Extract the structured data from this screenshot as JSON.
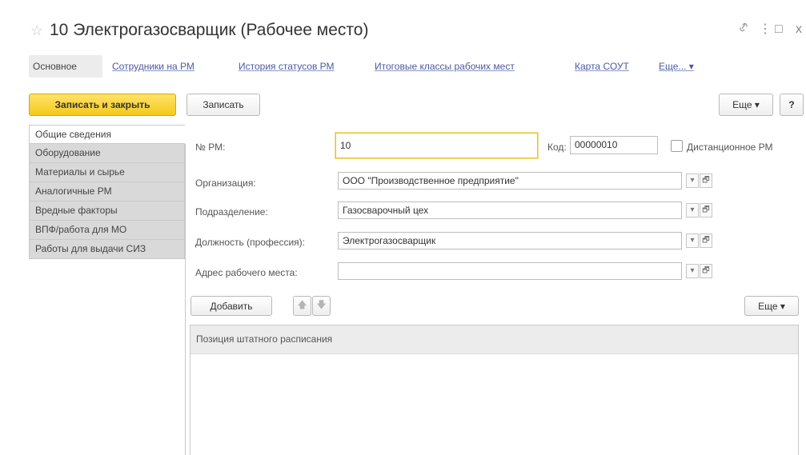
{
  "window": {
    "title": "10 Электрогазосварщик (Рабочее место)",
    "star_icon": "☆",
    "link_icon": "🔗",
    "menu_icon": "⋮",
    "maximize_icon": "□",
    "close_icon": "x"
  },
  "nav": {
    "items": [
      {
        "label": "Основное",
        "active": true
      },
      {
        "label": "Сотрудники на РМ"
      },
      {
        "label": "История статусов РМ"
      },
      {
        "label": "Итоговые классы рабочих мест"
      },
      {
        "label": "Карта СОУТ"
      },
      {
        "label": "Еще... ▾"
      }
    ]
  },
  "toolbar": {
    "save_close_label": "Записать и закрыть",
    "save_label": "Записать",
    "more_label": "Еще ▾",
    "help_label": "?"
  },
  "tabs": [
    {
      "label": "Общие сведения",
      "active": true
    },
    {
      "label": "Оборудование"
    },
    {
      "label": "Материалы и сырье"
    },
    {
      "label": "Аналогичные РМ"
    },
    {
      "label": "Вредные факторы"
    },
    {
      "label": "ВПФ/работа для МО"
    },
    {
      "label": "Работы для выдачи СИЗ"
    }
  ],
  "form": {
    "number_label": "№ РМ:",
    "number_value": "10",
    "code_label": "Код:",
    "code_value": "00000010",
    "remote_label": "Дистанционное РМ",
    "org_label": "Организация:",
    "org_value": "ООО \"Производственное предприятие\"",
    "dept_label": "Подразделение:",
    "dept_value": "Газосварочный цех",
    "position_label": "Должность (профессия):",
    "position_value": "Электрогазосварщик",
    "address_label": "Адрес рабочего места:",
    "address_value": "",
    "dropdown_glyph": "▾",
    "open_glyph": "🗗"
  },
  "list": {
    "add_label": "Добавить",
    "up_arrow": "🡅",
    "down_arrow": "🡇",
    "more_label": "Еще ▾",
    "column_header": "Позиция штатного расписания"
  }
}
